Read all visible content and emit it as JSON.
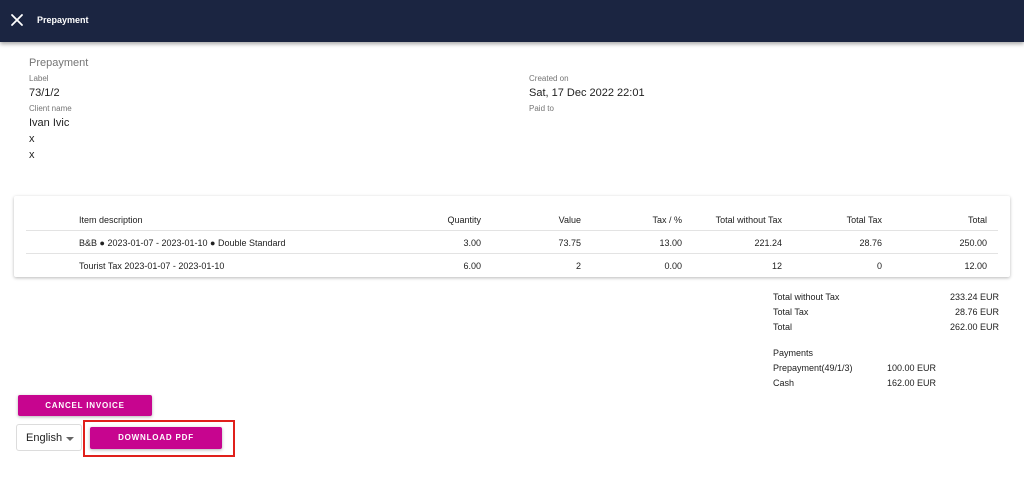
{
  "header": {
    "title": "Prepayment",
    "close_icon": "close-icon"
  },
  "info": {
    "section_title": "Prepayment",
    "label_caption": "Label",
    "label_value": "73/1/2",
    "client_caption": "Client name",
    "client_name": "Ivan Ivic",
    "client_line2": "x",
    "client_line3": "x",
    "created_caption": "Created on",
    "created_value": "Sat, 17 Dec 2022 22:01",
    "paid_to_caption": "Paid to"
  },
  "table": {
    "headers": [
      "Item description",
      "Quantity",
      "Value",
      "Tax / %",
      "Total without Tax",
      "Total Tax",
      "Total"
    ],
    "rows": [
      [
        "B&B ● 2023-01-07 - 2023-01-10 ● Double Standard",
        "3.00",
        "73.75",
        "13.00",
        "221.24",
        "28.76",
        "250.00"
      ],
      [
        "Tourist Tax 2023-01-07 - 2023-01-10",
        "6.00",
        "2",
        "0.00",
        "12",
        "0",
        "12.00"
      ]
    ]
  },
  "totals": [
    {
      "label": "Total without Tax",
      "value": "233.24 EUR"
    },
    {
      "label": "Total Tax",
      "value": "28.76 EUR"
    },
    {
      "label": "Total",
      "value": "262.00 EUR"
    }
  ],
  "payments": {
    "title": "Payments",
    "items": [
      {
        "label": "Prepayment(49/1/3)",
        "value": "100.00 EUR"
      },
      {
        "label": "Cash",
        "value": "162.00 EUR"
      }
    ]
  },
  "actions": {
    "cancel_label": "CANCEL INVOICE",
    "download_label": "DOWNLOAD PDF",
    "language_value": "English"
  },
  "colors": {
    "header_bg": "#1b2541",
    "accent": "#c7058f",
    "highlight": "#e0201b"
  }
}
